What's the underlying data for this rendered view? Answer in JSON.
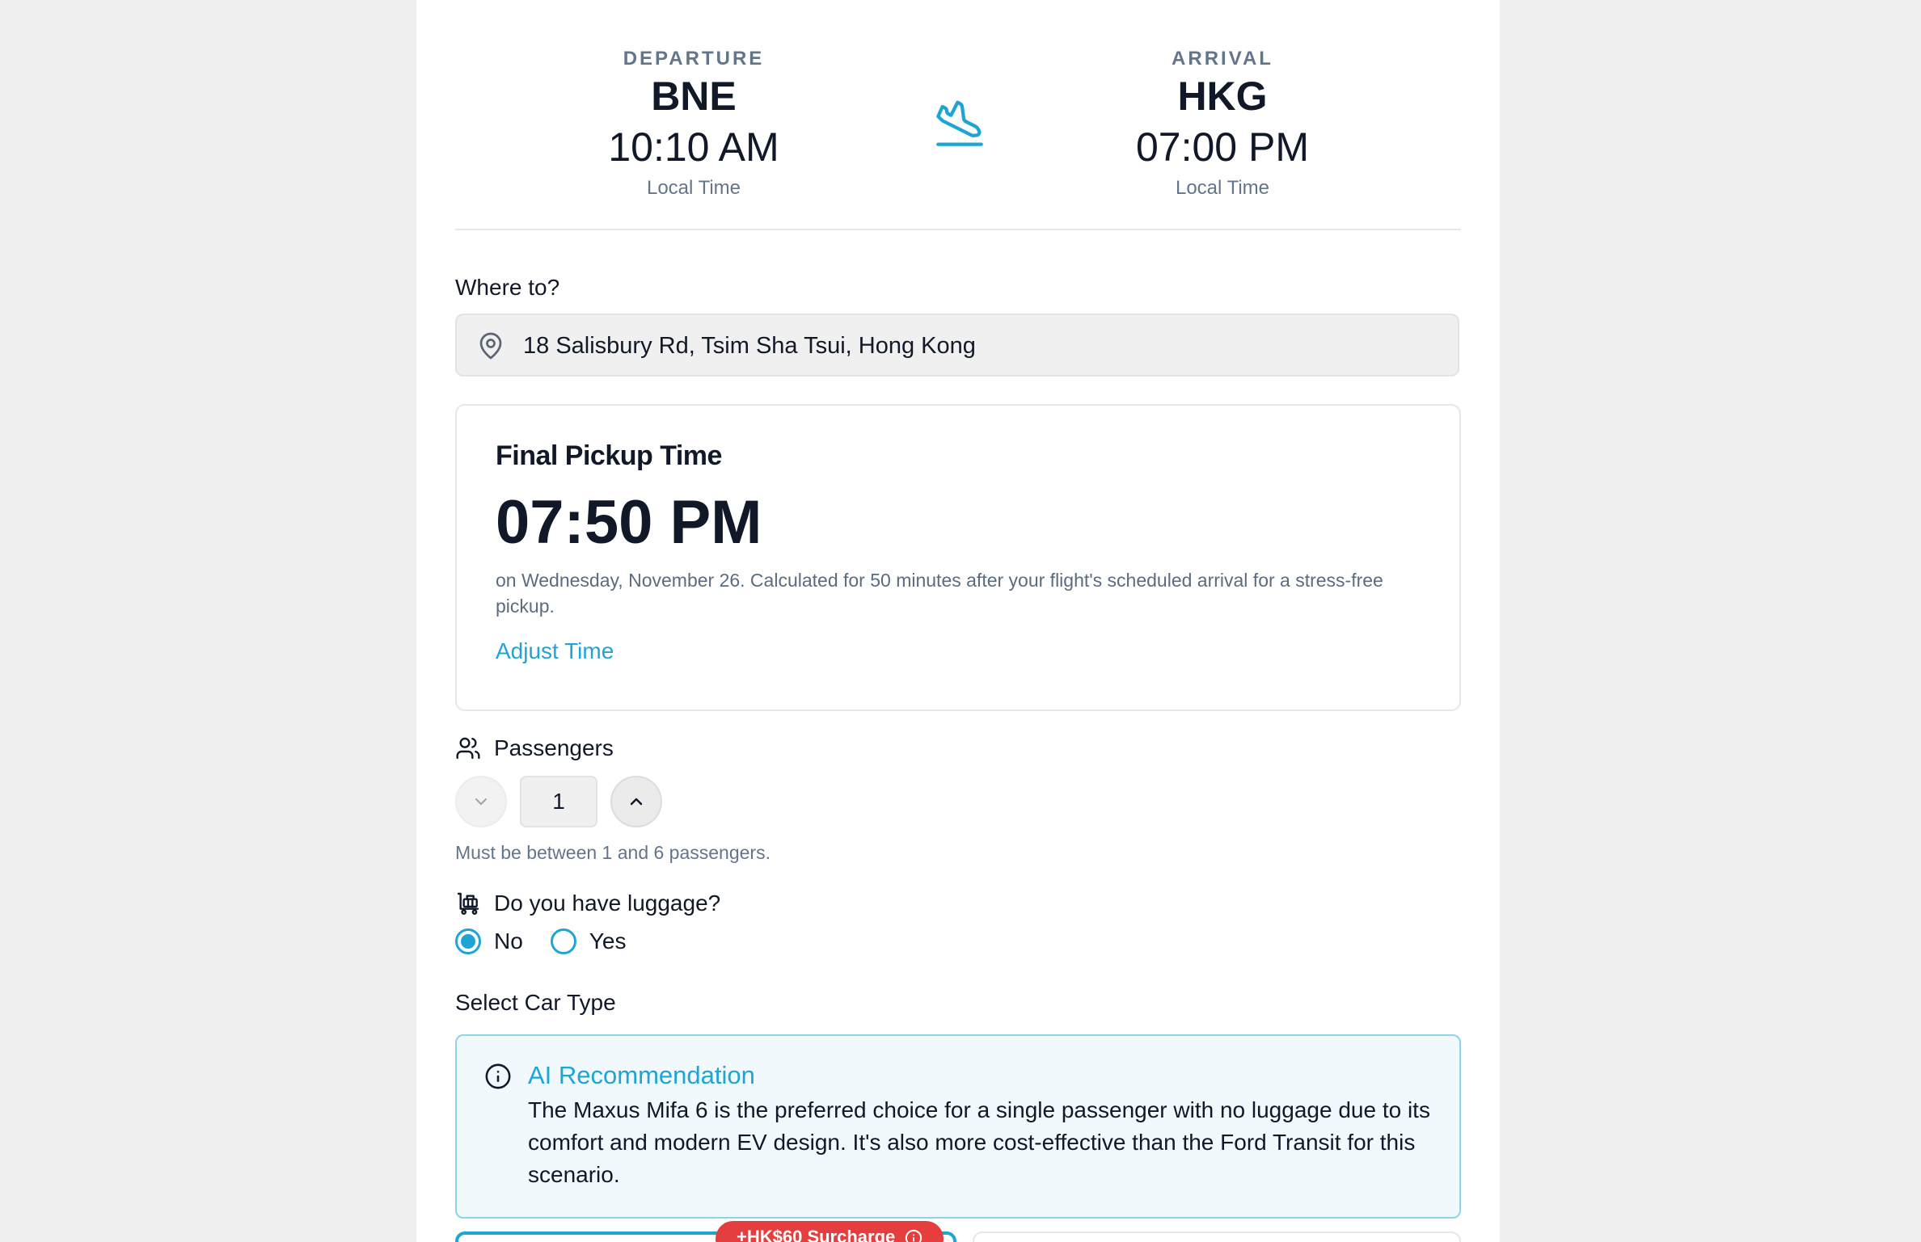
{
  "flight": {
    "departure": {
      "label": "DEPARTURE",
      "code": "BNE",
      "time": "10:10 AM",
      "sub": "Local Time"
    },
    "arrival": {
      "label": "ARRIVAL",
      "code": "HKG",
      "time": "07:00 PM",
      "sub": "Local Time"
    },
    "icon": "plane-landing-icon"
  },
  "destination": {
    "label": "Where to?",
    "value": "18 Salisbury Rd, Tsim Sha Tsui, Hong Kong",
    "icon": "map-pin-icon"
  },
  "pickup": {
    "title": "Final Pickup Time",
    "time": "07:50 PM",
    "description": "on Wednesday, November 26. Calculated for 50 minutes after your flight's scheduled arrival for a stress-free pickup.",
    "adjust_label": "Adjust Time"
  },
  "passengers": {
    "label": "Passengers",
    "value": "1",
    "hint": "Must be between 1 and 6 passengers.",
    "icon": "users-icon"
  },
  "luggage": {
    "label": "Do you have luggage?",
    "icon": "luggage-cart-icon",
    "options": [
      {
        "label": "No",
        "selected": true
      },
      {
        "label": "Yes",
        "selected": false
      }
    ]
  },
  "car_type": {
    "label": "Select Car Type",
    "ai": {
      "title": "AI Recommendation",
      "text": "The Maxus Mifa 6 is the preferred choice for a single passenger with no luggage due to its comfort and modern EV design. It's also more cost-effective than the Ford Transit for this scenario.",
      "icon": "info-icon"
    },
    "surcharge_badge": "+HK$60 Surcharge"
  },
  "colors": {
    "accent": "#1ea5d6",
    "text": "#111827",
    "muted": "#64748b",
    "surcharge": "#e53e3e",
    "background": "#efefef"
  }
}
